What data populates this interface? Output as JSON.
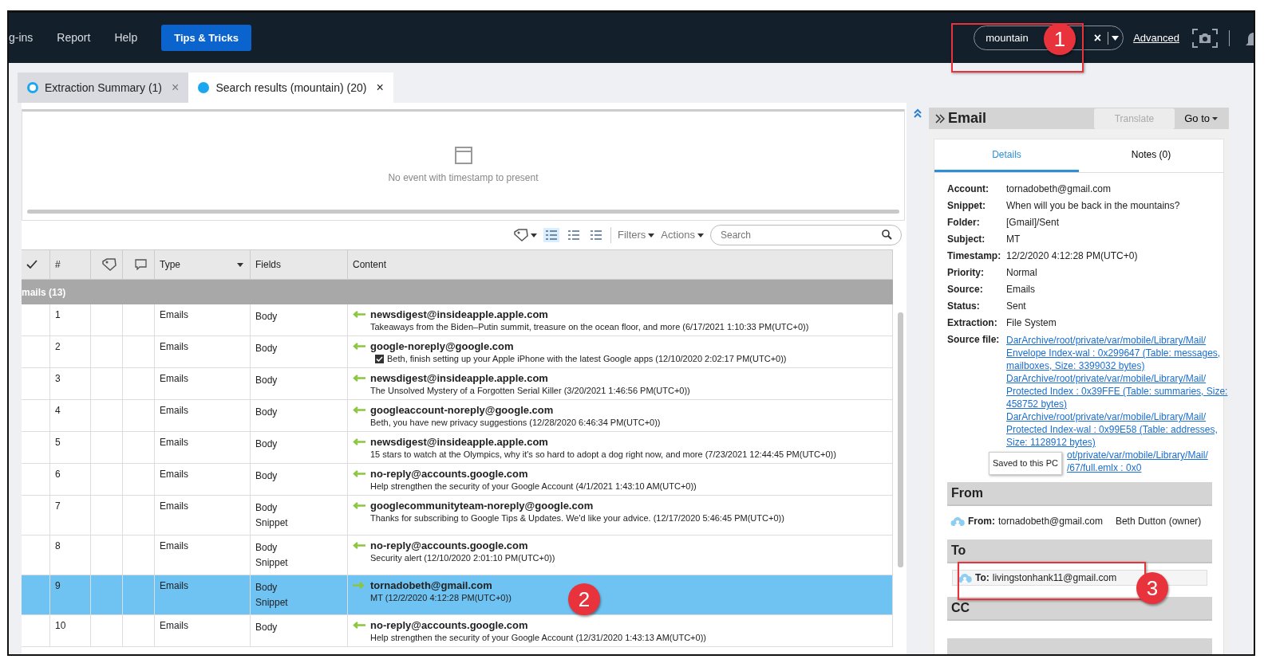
{
  "menu": {
    "items": [
      "g-ins",
      "Report",
      "Help"
    ],
    "tips_button": "Tips & Tricks"
  },
  "search": {
    "value": "mountain",
    "clear": "×",
    "advanced": "Advanced"
  },
  "tabs": [
    {
      "label": "Extraction Summary (1)",
      "selected": false,
      "close": "×"
    },
    {
      "label": "Search results (mountain) (20)",
      "selected": true,
      "close": "×"
    }
  ],
  "timeline": {
    "message": "No event with timestamp to present"
  },
  "toolbar": {
    "filters": "Filters",
    "actions": "Actions",
    "search_placeholder": "Search"
  },
  "table": {
    "columns": [
      "#",
      "Type",
      "Fields",
      "Content"
    ],
    "group": "mails (13)",
    "rows": [
      {
        "number": "1",
        "type": "Emails",
        "fields": [
          "Body"
        ],
        "sender": "newsdigest@insideapple.apple.com",
        "snippet": "Takeaways from the Biden–Putin summit, treasure on the ocean floor, and more (6/17/2021 1:10:33 PM(UTC+0))",
        "kind": "incoming",
        "checkmark": false,
        "selected": false
      },
      {
        "number": "2",
        "type": "Emails",
        "fields": [
          "Body"
        ],
        "sender": "google-noreply@google.com",
        "snippet": "Beth, finish setting up your Apple iPhone with the latest Google apps (12/10/2020 2:02:17 PM(UTC+0))",
        "kind": "incoming",
        "checkmark": true,
        "selected": false
      },
      {
        "number": "3",
        "type": "Emails",
        "fields": [
          "Body"
        ],
        "sender": "newsdigest@insideapple.apple.com",
        "snippet": "The Unsolved Mystery of a Forgotten Serial Killer (3/20/2021 1:46:56 PM(UTC+0))",
        "kind": "incoming",
        "checkmark": false,
        "selected": false
      },
      {
        "number": "4",
        "type": "Emails",
        "fields": [
          "Body"
        ],
        "sender": "googleaccount-noreply@google.com",
        "snippet": "Beth, you have new privacy suggestions (12/28/2020 6:46:34 PM(UTC+0))",
        "kind": "incoming",
        "checkmark": false,
        "selected": false
      },
      {
        "number": "5",
        "type": "Emails",
        "fields": [
          "Body"
        ],
        "sender": "newsdigest@insideapple.apple.com",
        "snippet": "15 stars to watch at the Olympics, why it's so hard to adopt a dog right now, and more (7/23/2021 12:44:45 PM(UTC+0))",
        "kind": "incoming",
        "checkmark": false,
        "selected": false
      },
      {
        "number": "6",
        "type": "Emails",
        "fields": [
          "Body"
        ],
        "sender": "no-reply@accounts.google.com",
        "snippet": "Help strengthen the security of your Google Account (4/1/2021 1:43:10 AM(UTC+0))",
        "kind": "incoming",
        "checkmark": false,
        "selected": false
      },
      {
        "number": "7",
        "type": "Emails",
        "fields": [
          "Body",
          "Snippet"
        ],
        "sender": "googlecommunityteam-noreply@google.com",
        "snippet": "Thanks for subscribing to Google Tips & Updates. We'd like your advice. (12/17/2020 5:46:45 PM(UTC+0))",
        "kind": "incoming",
        "checkmark": false,
        "selected": false
      },
      {
        "number": "8",
        "type": "Emails",
        "fields": [
          "Body",
          "Snippet"
        ],
        "sender": "no-reply@accounts.google.com",
        "snippet": "Security alert (12/10/2020 2:01:10 PM(UTC+0))",
        "kind": "incoming",
        "checkmark": false,
        "selected": false
      },
      {
        "number": "9",
        "type": "Emails",
        "fields": [
          "Body",
          "Snippet"
        ],
        "sender": "tornadobeth@gmail.com",
        "snippet": "MT (12/2/2020 4:12:28 PM(UTC+0))",
        "kind": "outgoing",
        "checkmark": false,
        "selected": true
      },
      {
        "number": "10",
        "type": "Emails",
        "fields": [
          "Body"
        ],
        "sender": "no-reply@accounts.google.com",
        "snippet": "Help strengthen the security of your Google Account (12/31/2020 1:43:13 AM(UTC+0))",
        "kind": "incoming",
        "checkmark": false,
        "selected": false
      }
    ]
  },
  "email_panel": {
    "title": "Email",
    "translate": {
      "label": "Translate",
      "disabled": true
    },
    "goto": "Go to",
    "tabs": [
      {
        "label": "Details",
        "selected": true
      },
      {
        "label": "Notes (0)",
        "selected": false
      }
    ],
    "details": [
      {
        "key": "Account:",
        "value": "tornadobeth@gmail.com"
      },
      {
        "key": "Snippet:",
        "value": "When will you be back in the mountains?"
      },
      {
        "key": "Folder:",
        "value": "[Gmail]/Sent"
      },
      {
        "key": "Subject:",
        "value": "MT"
      },
      {
        "key": "Timestamp:",
        "value": "12/2/2020 4:12:28 PM(UTC+0)"
      },
      {
        "key": "Priority:",
        "value": "Normal"
      },
      {
        "key": "Source:",
        "value": "Emails"
      },
      {
        "key": "Status:",
        "value": "Sent"
      },
      {
        "key": "Extraction:",
        "value": "File System"
      }
    ],
    "source_label": "Source file:",
    "source_links": [
      [
        "DarArchive/root/private/var/mobile/Library/Mail/",
        "Envelope Index-wal : 0x299647 (Table: messages,",
        "mailboxes, Size: 3399032 bytes)"
      ],
      [
        "DarArchive/root/private/var/mobile/Library/Mail/",
        "Protected Index : 0x39FFE (Table: summaries, Size:",
        "458752 bytes)"
      ],
      [
        "DarArchive/root/private/var/mobile/Library/Mail/",
        "Protected Index-wal : 0x99E58 (Table: addresses,",
        "Size: 1128912 bytes)"
      ]
    ],
    "partial_link_lines": [
      "ot/private/var/mobile/Library/Mail/",
      "/67/full.emlx : 0x0"
    ],
    "tooltip": "Saved to this PC",
    "from": {
      "heading": "From",
      "label": "From:",
      "address": "tornadobeth@gmail.com",
      "name": "Beth Dutton (owner)"
    },
    "to": {
      "heading": "To",
      "label": "To:",
      "address": "livingstonhank11@gmail.com"
    },
    "cc": {
      "heading": "CC"
    }
  },
  "callouts": [
    {
      "number": "1"
    },
    {
      "number": "2"
    },
    {
      "number": "3"
    }
  ]
}
